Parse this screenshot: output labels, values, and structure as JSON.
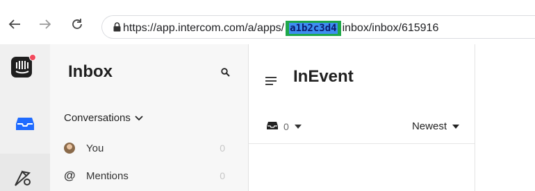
{
  "browser": {
    "url_prefix": "https://app.intercom.com/a/apps/",
    "url_highlight": "a1b2c3d4",
    "url_suffix": "inbox/inbox/615916",
    "icons": [
      "back-arrow-icon",
      "forward-arrow-icon",
      "reload-icon",
      "lock-icon"
    ]
  },
  "rail": {
    "icons": [
      "intercom-logo-icon",
      "inbox-icon",
      "outbound-icon"
    ],
    "logo_dot_color": "#f2495c",
    "accent_color": "#1f6bff"
  },
  "sidebar": {
    "title": "Inbox",
    "section_label": "Conversations",
    "items": [
      {
        "label": "You",
        "count": "0",
        "icon": "avatar-icon"
      },
      {
        "label": "Mentions",
        "count": "0",
        "icon": "at-icon"
      }
    ]
  },
  "list": {
    "title": "InEvent",
    "open_count": "0",
    "sort_label": "Newest"
  }
}
